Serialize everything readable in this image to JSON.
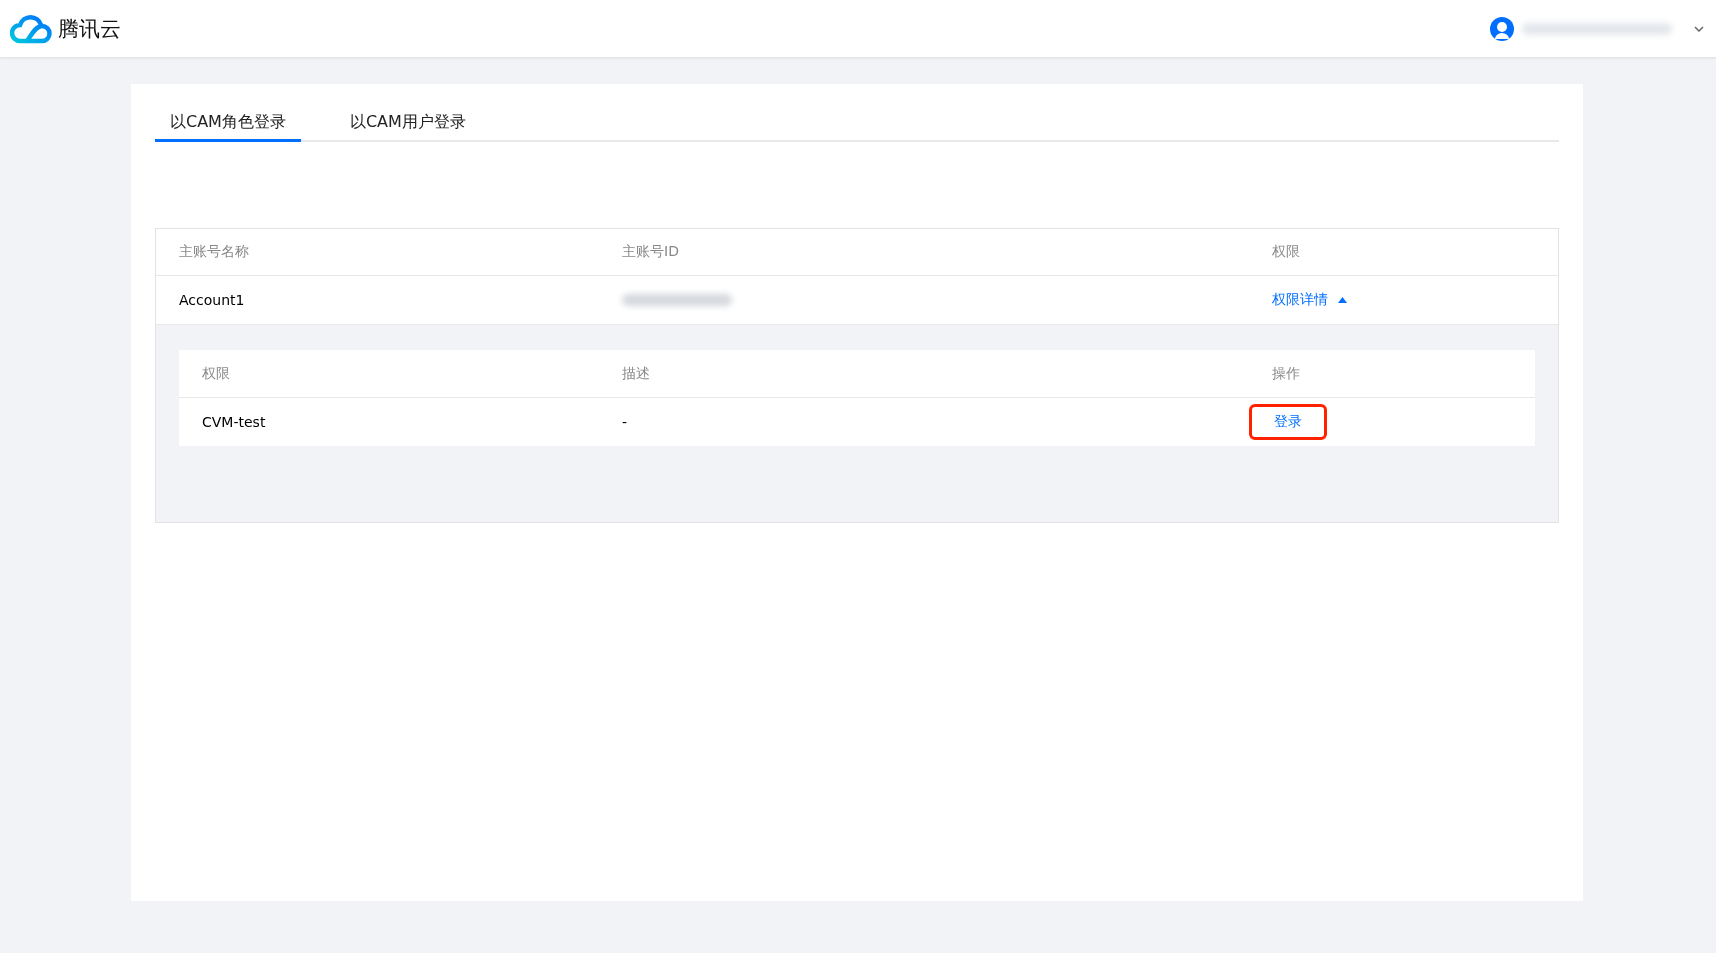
{
  "header": {
    "brand": "腾讯云"
  },
  "tabs": [
    {
      "label": "以CAM角色登录",
      "selected": true
    },
    {
      "label": "以CAM用户登录",
      "selected": false
    }
  ],
  "accounts_table": {
    "columns": [
      "主账号名称",
      "主账号ID",
      "权限"
    ],
    "rows": [
      {
        "name": "Account1",
        "details_link": "权限详情",
        "expanded": true,
        "permissions_table": {
          "columns": [
            "权限",
            "描述",
            "操作"
          ],
          "rows": [
            {
              "permission": "CVM-test",
              "description": "-",
              "action": "登录",
              "highlighted": true
            }
          ]
        }
      }
    ]
  }
}
